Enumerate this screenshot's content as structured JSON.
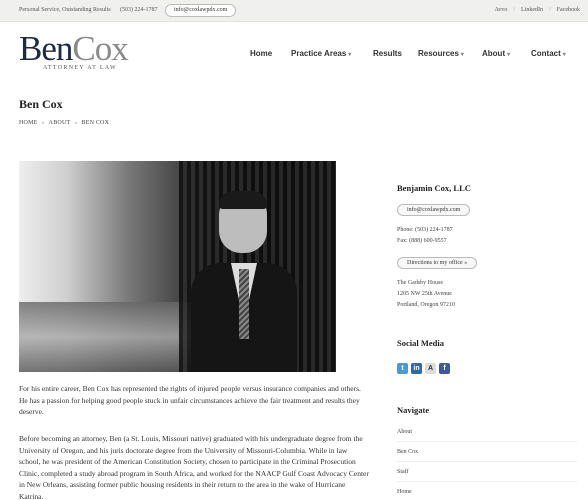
{
  "topbar": {
    "tagline": "Personal Service, Outstanding Results",
    "phone": "(503) 224-1787",
    "email": "info@coxlawpdx.com",
    "social": [
      "Avvo",
      "LinkedIn",
      "Facebook"
    ],
    "separator": "/"
  },
  "logo": {
    "part1": "Ben",
    "part2": "Cox",
    "subtitle": "ATTORNEY AT LAW"
  },
  "nav": {
    "home": "Home",
    "practice_areas": "Practice Areas",
    "results": "Results",
    "resources": "Resources",
    "about": "About",
    "contact": "Contact",
    "caret": "▾"
  },
  "page": {
    "title": "Ben Cox",
    "breadcrumb": [
      "HOME",
      "ABOUT",
      "BEN COX"
    ],
    "breadcrumb_sep": "»",
    "paragraph1": "For his entire career, Ben Cox has represented the rights of injured people versus insurance companies and others. He has a passion for helping good people stuck in unfair circumstances achieve the fair treatment and results they deserve.",
    "paragraph2": "Before becoming an attorney, Ben (a St. Louis, Missouri native) graduated with his undergraduate degree from the University of Oregon, and his juris doctorate degree from the University of Missouri-Columbia. While in law school, he was president of the American Constitution Society, chosen to participate in the Criminal Prosecution Clinic, completed a study abroad program in South Africa, and worked for the NAACP Gulf Coast Advocacy Center in New Orleans, assisting former public housing residents in their return to the area in the wake of Hurricane Katrina."
  },
  "sidebar": {
    "firm_name": "Benjamin Cox, LLC",
    "email": "info@coxlawpdx.com",
    "phone": "Phone: (503) 224-1787",
    "fax": "Fax: (888) 600-9557",
    "directions": "Directions to my office »",
    "address": [
      "The Gadsby House",
      "1205 NW 25th Avenue",
      "Portland, Oregon 97210"
    ],
    "social_heading": "Social Media",
    "social_icons": [
      {
        "name": "twitter-icon",
        "glyph": "t",
        "color": "#4a9ad6"
      },
      {
        "name": "linkedin-icon",
        "glyph": "in",
        "color": "#2a6aa8"
      },
      {
        "name": "avvo-icon",
        "glyph": "A",
        "color": "#dcdcdc"
      },
      {
        "name": "facebook-icon",
        "glyph": "f",
        "color": "#3b5b9a"
      }
    ],
    "navigate_heading": "Navigate",
    "navigate_items": [
      "About",
      "Ben Cox",
      "Staff",
      "Home"
    ]
  }
}
